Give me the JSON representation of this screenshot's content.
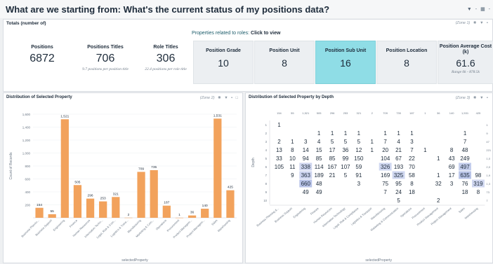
{
  "header": {
    "title": "What are we starting from: What's the current status of my positions data?",
    "controls": [
      "▼",
      "-",
      "▦",
      "-"
    ]
  },
  "zone1": {
    "title": "Totals (number of)",
    "tag": "(Zone 1)",
    "totals": [
      {
        "label": "Positions",
        "value": "6872",
        "sub": ""
      },
      {
        "label": "Positions Titles",
        "value": "706",
        "sub": "9.7 positions per position title"
      },
      {
        "label": "Role Titles",
        "value": "306",
        "sub": "22.4 positions per role title"
      }
    ],
    "properties_prefix": "Properties related to roles: ",
    "properties_action": "Click to view",
    "properties": [
      {
        "label": "Position Grade",
        "value": "10",
        "sub": "",
        "active": false
      },
      {
        "label": "Position Unit",
        "value": "8",
        "sub": "",
        "active": false
      },
      {
        "label": "Position Sub Unit",
        "value": "16",
        "sub": "",
        "active": true
      },
      {
        "label": "Position Location",
        "value": "8",
        "sub": "",
        "active": false
      },
      {
        "label": "Position Average Cost (k)",
        "value": "61.6",
        "sub": "Range 0k - 878.5k",
        "active": false
      }
    ]
  },
  "zone2": {
    "title": "Distribution of Selected Property",
    "tag": "(Zone 2)"
  },
  "zone3": {
    "title": "Distribution of Selected Property by Depth",
    "tag": "(Zone 3)"
  },
  "chart_data": [
    {
      "type": "bar",
      "title": "Distribution of Selected Property",
      "xlabel": "selectedProperty",
      "ylabel": "Count of Records",
      "ylim": [
        0,
        1600
      ],
      "yticks": [
        200,
        400,
        600,
        800,
        "1,000",
        "1,200",
        "1,400",
        "1,600"
      ],
      "categories": [
        "Business Plannin...",
        "Business Support",
        "Engineering",
        "Finance",
        "Human Resources",
        "Information Techn...",
        "Legal, Risk & Com...",
        "Logistics & Trans...",
        "Manufacturing",
        "Marketing & Com...",
        "Operations",
        "Procurement",
        "Product Managem...",
        "Project Managem...",
        "Sales",
        "Warehousing"
      ],
      "values": [
        154,
        55,
        1521,
        505,
        296,
        253,
        321,
        2,
        709,
        735,
        187,
        1,
        36,
        140,
        1531,
        425
      ],
      "labels": [
        "154",
        "55",
        "1,521",
        "505",
        "296",
        "253",
        "321",
        "2",
        "709",
        "735",
        "187",
        "1",
        "36",
        "140",
        "1,531",
        "425"
      ],
      "color": "#f2a25c"
    },
    {
      "type": "heatmap",
      "title": "Distribution of Selected Property by Depth",
      "xlabel": "selectedProperty",
      "ylabel": "Depth",
      "categories": [
        "Business Planning &...",
        "Business Support",
        "Engineering",
        "Finance",
        "Human Resources",
        "Information Technology",
        "Legal, Risk & Compliance",
        "Logistics & Transport",
        "Manufacturing",
        "Marketing & Communication",
        "Operations",
        "Procurement",
        "Product Management",
        "Project Management",
        "Sales",
        "Warehousing"
      ],
      "column_totals": [
        "154",
        "55",
        "1,521",
        "505",
        "296",
        "253",
        "321",
        "2",
        "709",
        "735",
        "187",
        "1",
        "36",
        "140",
        "1,531",
        "425"
      ],
      "rows": [
        "1",
        "2",
        "3",
        "4",
        "5",
        "6",
        "7",
        "8",
        "9",
        "10"
      ],
      "row_totals": [
        "1",
        "9",
        "47",
        "221",
        "1,0",
        "2,0",
        "1,9",
        "1,3",
        "73",
        "7"
      ],
      "cells": [
        [
          "1",
          "",
          "",
          "",
          "",
          "",
          "",
          "",
          "",
          "",
          "",
          "",
          "",
          "",
          "",
          ""
        ],
        [
          "",
          "",
          "",
          "1",
          "1",
          "1",
          "1",
          "",
          "1",
          "1",
          "1",
          "",
          "",
          "",
          "1",
          ""
        ],
        [
          "2",
          "1",
          "3",
          "4",
          "5",
          "5",
          "5",
          "1",
          "7",
          "4",
          "3",
          "",
          "",
          "",
          "7",
          ""
        ],
        [
          "13",
          "8",
          "14",
          "15",
          "17",
          "36",
          "12",
          "1",
          "20",
          "21",
          "7",
          "1",
          "",
          "8",
          "48",
          ""
        ],
        [
          "33",
          "10",
          "94",
          "85",
          "85",
          "99",
          "150",
          "",
          "104",
          "67",
          "22",
          "",
          "1",
          "43",
          "249",
          ""
        ],
        [
          "105",
          "11",
          "338",
          "114",
          "167",
          "107",
          "59",
          "",
          "326",
          "193",
          "70",
          "",
          "",
          "69",
          "497",
          ""
        ],
        [
          "",
          "9",
          "363",
          "189",
          "21",
          "5",
          "91",
          "",
          "169",
          "325",
          "58",
          "",
          "1",
          "17",
          "635",
          "98"
        ],
        [
          "",
          "",
          "660",
          "48",
          "",
          "",
          "3",
          "",
          "75",
          "95",
          "8",
          "",
          "32",
          "3",
          "76",
          "319"
        ],
        [
          "",
          "",
          "49",
          "49",
          "",
          "",
          "",
          "",
          "7",
          "24",
          "18",
          "",
          "",
          "",
          "18",
          "8"
        ],
        [
          "",
          "",
          "",
          "",
          "",
          "",
          "",
          "",
          "",
          "5",
          "",
          "",
          "2",
          "",
          "",
          ""
        ]
      ],
      "highlight_color": "#b8c3e8"
    }
  ]
}
